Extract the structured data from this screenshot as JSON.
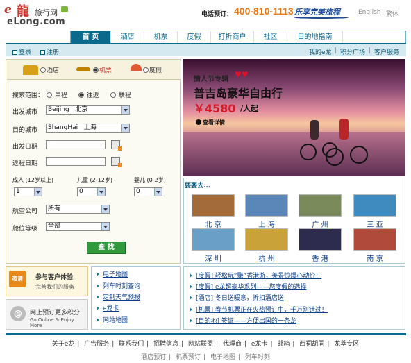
{
  "header": {
    "logo_e": "e",
    "logo_cn": "龍",
    "logo_sub": "旅行网",
    "logo_url": "eLong.com",
    "phone_label": "电话预订：",
    "phone_number": "400-810-1113",
    "slogan": "乐享完美旅程",
    "lang_en": "English",
    "lang_sep": "|",
    "lang_tw": "繁体"
  },
  "nav": {
    "items": [
      {
        "label": "首 页",
        "active": true
      },
      {
        "label": "酒店"
      },
      {
        "label": "机票"
      },
      {
        "label": "度假"
      },
      {
        "label": "打折商户"
      },
      {
        "label": "社区"
      },
      {
        "label": "目的地指南"
      }
    ]
  },
  "subbar": {
    "login": "登录",
    "register": "注册",
    "my_elong": "我的e龙",
    "points": "积分广场",
    "service": "客户服务",
    "sep": "|"
  },
  "search": {
    "tabs": [
      {
        "label": "酒店",
        "icon": "hotel-icon"
      },
      {
        "label": "机票",
        "icon": "plane-icon",
        "selected": true
      },
      {
        "label": "度假",
        "icon": "umbrella-icon"
      }
    ],
    "scope_label": "搜索范围：",
    "scope_options": [
      "单程",
      "往返",
      "联程"
    ],
    "scope_selected": "往返",
    "depart_city_label": "出发城市",
    "depart_city_value": "Beijing   北京",
    "arrive_city_label": "目的城市",
    "arrive_city_value": "ShangHai   上海",
    "depart_date_label": "出发日期",
    "return_date_label": "返程日期",
    "adult_label": "成人 (12岁以上)",
    "adult_value": "1",
    "child_label": "儿童 (2-12岁)",
    "child_value": "0",
    "infant_label": "婴儿 (0-2岁)",
    "infant_value": "0",
    "airline_label": "航空公司",
    "airline_value": "所有",
    "cabin_label": "舱位等级",
    "cabin_value": "全部",
    "submit": "查 找"
  },
  "banner": {
    "subtitle": "情人节专辑",
    "title": "普吉岛豪华自由行",
    "price": "￥4580",
    "price_unit": "/人起",
    "more": "查看详情"
  },
  "destinations": {
    "heading": "要要去...",
    "items": [
      {
        "name": "北 京",
        "color": "#a36a3a"
      },
      {
        "name": "上 海",
        "color": "#5a86b8"
      },
      {
        "name": "广 州",
        "color": "#7a8a5a"
      },
      {
        "name": "三 亚",
        "color": "#3f8bc0"
      },
      {
        "name": "深 圳",
        "color": "#6aa0c8"
      },
      {
        "name": "杭 州",
        "color": "#c9a23a"
      },
      {
        "name": "香 港",
        "color": "#2d2b4e"
      },
      {
        "name": "南 京",
        "color": "#b04a3a"
      }
    ]
  },
  "promos": {
    "promo1_badge": "邀请",
    "promo1_title": "参与客户体验",
    "promo1_sub": "完善我们的服务",
    "promo2_title": "网上预订更多积分",
    "promo2_sub": "Go Online & Enjoy More"
  },
  "quick_links": [
    "电子地图",
    "列车时刻查询",
    "定制天气预报",
    "e龙卡",
    "网站地图"
  ],
  "news": [
    "[度假] 轻松玩“赚”香港游，美景惊爆心动价！",
    "[度假] e龙超豪华系列——您度假的选择",
    "[酒店] 冬日送暖意，折扣酒店送",
    "[机票] 春节机票正在火热预订中，千万别错过！",
    "[目的地] 签证——方便出国的一条龙"
  ],
  "footer": {
    "row1": [
      "关于e龙",
      "广告服务",
      "联系我们",
      "招聘信息",
      "网站联盟",
      "代理商",
      "e龙卡",
      "邮箱",
      "西祠胡同",
      "龙萃专区"
    ],
    "row2": [
      "酒店预订",
      "机票预订",
      "电子地图",
      "列车时刻"
    ],
    "sep": "|"
  }
}
